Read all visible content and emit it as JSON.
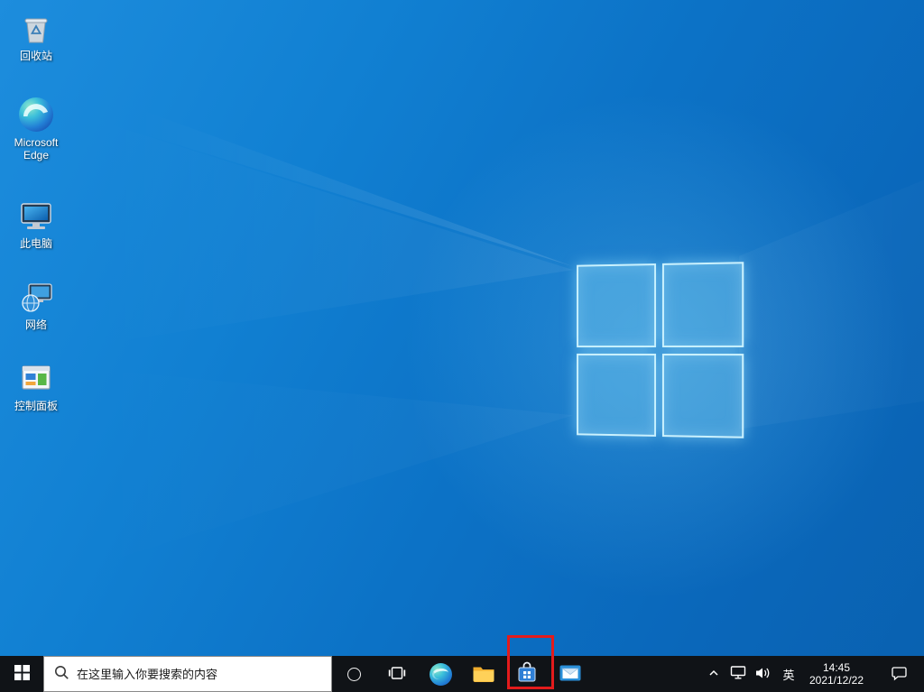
{
  "desktop": {
    "icons": [
      {
        "icon": "recycle-bin-icon",
        "label": "回收站"
      },
      {
        "icon": "edge-icon",
        "label": "Microsoft Edge"
      },
      {
        "icon": "this-pc-icon",
        "label": "此电脑"
      },
      {
        "icon": "network-icon",
        "label": "网络"
      },
      {
        "icon": "control-panel-icon",
        "label": "控制面板"
      }
    ]
  },
  "taskbar": {
    "search": {
      "placeholder": "在这里输入你要搜索的内容"
    },
    "pinned_icons": [
      "start-icon",
      "cortana-icon",
      "task-view-icon",
      "edge-icon",
      "file-explorer-icon",
      "microsoft-store-icon",
      "mail-icon"
    ],
    "tray": {
      "ime_label": "英",
      "time": "14:45",
      "date": "2021/12/22"
    }
  },
  "annotation": {
    "color": "#e31b1c"
  }
}
